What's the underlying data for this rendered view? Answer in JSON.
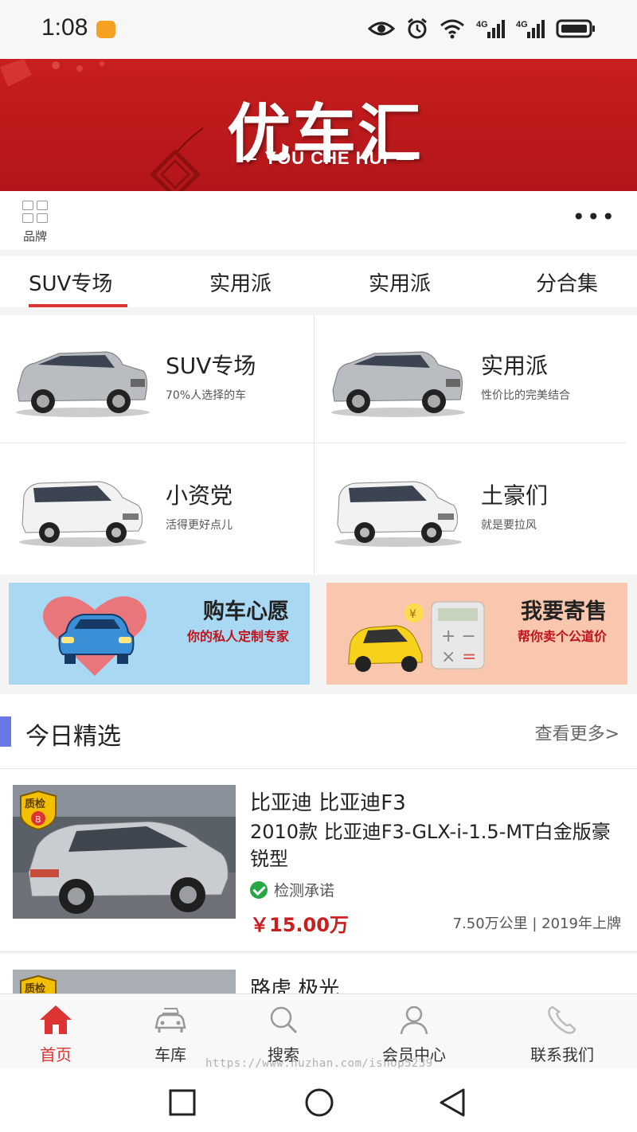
{
  "status_bar": {
    "time": "1:08",
    "network_1": "4G",
    "network_2": "4G"
  },
  "banner": {
    "logo_cn": "优车汇",
    "logo_en": "YOU CHE HUI"
  },
  "brand_row": {
    "brand_label": "品牌",
    "more_icon": "more-dots-icon"
  },
  "tabs": [
    {
      "label": "SUV专场",
      "active": true
    },
    {
      "label": "实用派",
      "active": false
    },
    {
      "label": "实用派",
      "active": false
    },
    {
      "label": "分合集",
      "active": false
    }
  ],
  "categories": [
    {
      "name": "SUV专场",
      "sub": "70%人选择的车"
    },
    {
      "name": "实用派",
      "sub": "性价比的完美结合"
    },
    {
      "name": "小资党",
      "sub": "活得更好点儿"
    },
    {
      "name": "土豪们",
      "sub": "就是要拉风"
    }
  ],
  "promos": [
    {
      "title": "购车心愿",
      "sub": "你的私人定制专家",
      "bg": "#a8d8f2"
    },
    {
      "title": "我要寄售",
      "sub": "帮你卖个公道价",
      "bg": "#f9c7ad"
    }
  ],
  "picks": {
    "title": "今日精选",
    "more": "查看更多>"
  },
  "listings": [
    {
      "badge": "质检",
      "badge_grade": "B",
      "brand": "比亚迪 比亚迪F3",
      "model": "2010款 比亚迪F3-GLX-i-1.5-MT白金版豪锐型",
      "cert": "检测承诺",
      "price": "￥15.00万",
      "meta": "7.50万公里 | 2019年上牌"
    },
    {
      "badge": "质检",
      "brand": "路虎 极光"
    }
  ],
  "bottom_nav": [
    {
      "label": "首页",
      "icon": "home-icon",
      "active": true
    },
    {
      "label": "车库",
      "icon": "garage-car-icon",
      "active": false
    },
    {
      "label": "搜索",
      "icon": "search-icon",
      "active": false
    },
    {
      "label": "会员中心",
      "icon": "user-icon",
      "active": false
    },
    {
      "label": "联系我们",
      "icon": "phone-icon",
      "active": false
    }
  ],
  "watermark": "https://www.huzhan.com/ishop5239",
  "colors": {
    "accent": "#d33333",
    "banner": "#c81e1e",
    "price": "#c81e1e"
  }
}
